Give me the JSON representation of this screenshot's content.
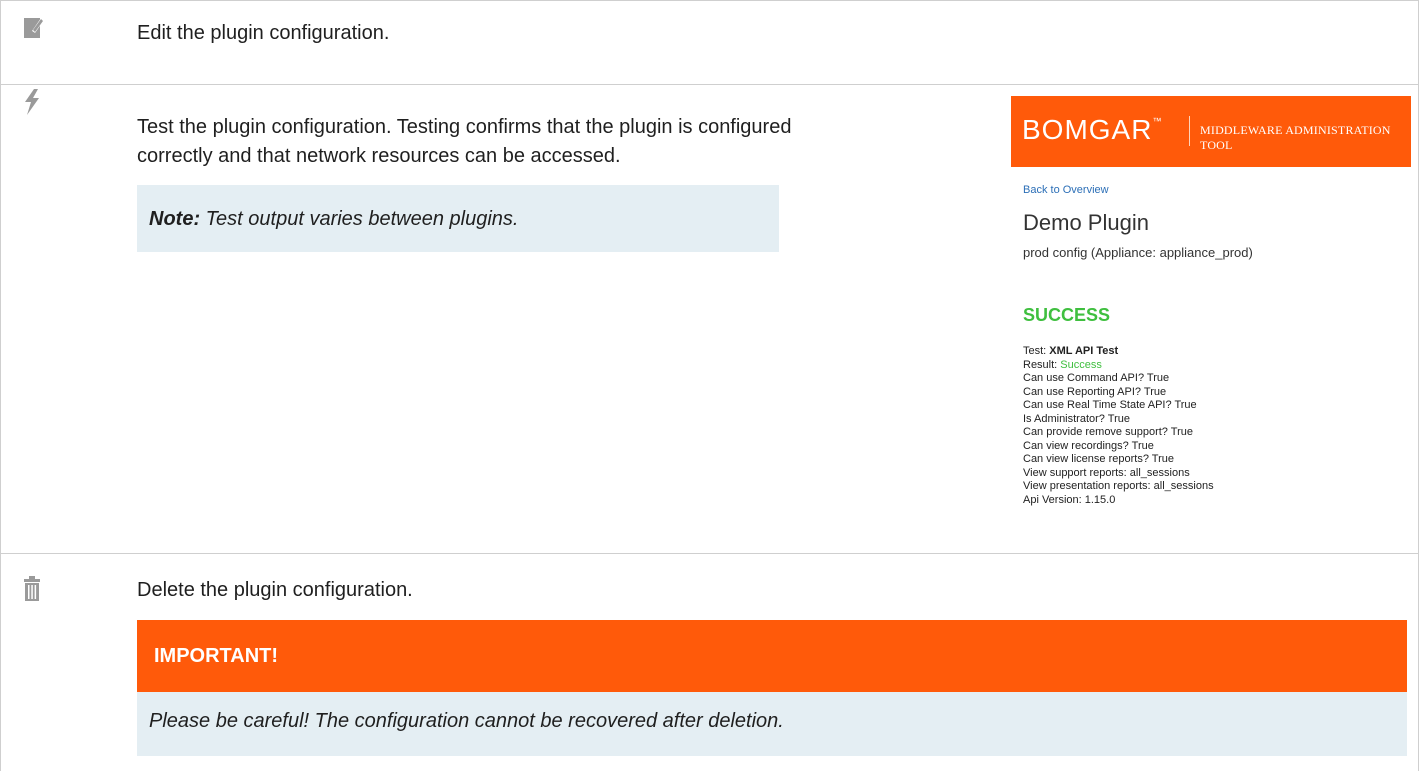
{
  "rows": [
    {
      "icon": "edit-icon",
      "text": "Edit the plugin configuration."
    },
    {
      "icon": "lightning-icon",
      "text_line1": "Test the plugin configuration. Testing confirms that the plugin is configured",
      "text_line2": "correctly and that network resources can be accessed."
    },
    {
      "icon": "trash-icon",
      "text": "Delete the plugin configuration."
    }
  ],
  "note": {
    "label": "Note:",
    "text": " Test output varies between plugins."
  },
  "screenshot": {
    "brand": "BOMGAR",
    "tm": "™",
    "tool": "MIDDLEWARE ADMINISTRATION TOOL",
    "back_link": "Back to Overview",
    "plugin_name": "Demo Plugin",
    "config_line": "prod config (Appliance: appliance_prod)",
    "status": "SUCCESS",
    "test_label": "Test: ",
    "test_name": "XML API Test",
    "result_label": "Result: ",
    "result_value": "Success",
    "lines": [
      "Can use Command API? True",
      "Can use Reporting API? True",
      "Can use Real Time State API? True",
      "Is Administrator? True",
      "Can provide remove support? True",
      "Can view recordings? True",
      "Can view license reports? True",
      "View support reports: all_sessions",
      "View presentation reports: all_sessions",
      "Api Version: 1.15.0"
    ]
  },
  "important": {
    "title": "IMPORTANT!",
    "text": "Please be careful! The configuration cannot be recovered after deletion."
  },
  "colors": {
    "accent": "#ff5a0a",
    "note_bg": "#e4eef3",
    "success": "#3fbf3f",
    "link": "#2c6fb7"
  }
}
